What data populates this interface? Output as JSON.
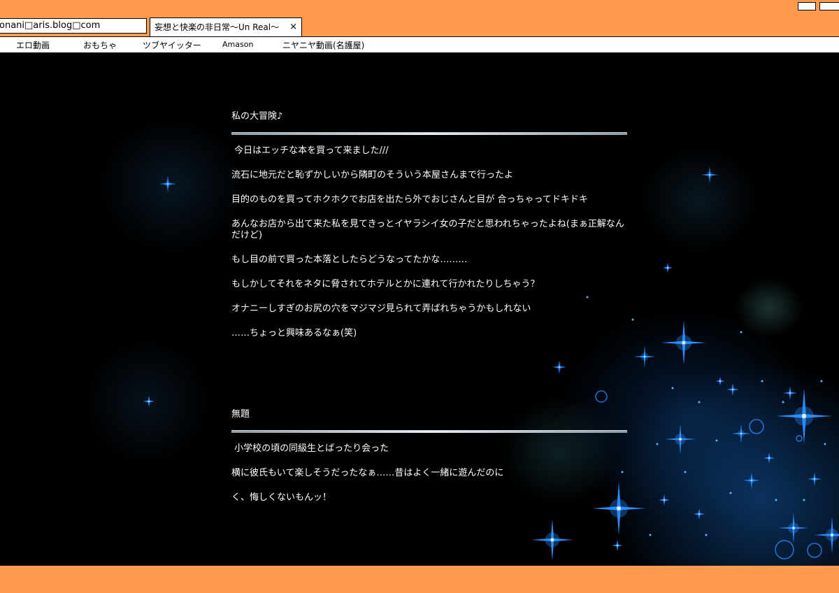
{
  "browser": {
    "address": "onani□aris.blog□com",
    "tab_title": "妄想と快楽の非日常〜Un Real〜",
    "tab_close": "×",
    "bookmarks": [
      "エロ動画",
      "おもちゃ",
      "ツブヤイッター",
      "Amason",
      "ニヤニヤ動画(名護屋)"
    ]
  },
  "posts": [
    {
      "title": "私の大冒険♪",
      "lines": [
        " 今日はエッチな本を買って来ました///",
        "流石に地元だと恥ずかしいから隣町のそういう本屋さんまで行ったよ",
        "目的のものを買ってホクホクでお店を出たら外でおじさんと目が 合っちゃってドキドキ",
        "あんなお店から出て来た私を見てきっとイヤラシイ女の子だと思われちゃったよね(まぁ正解なんだけど)",
        "もし目の前で買った本落としたらどうなってたかな………",
        "もしかしてそれをネタに脅されてホテルとかに連れて行かれたりしちゃう？",
        "オナニーしすぎのお尻の穴をマジマジ見られて弄ばれちゃうかもしれない",
        "……ちょっと興味あるなぁ(笑)"
      ]
    },
    {
      "title": "無題",
      "lines": [
        " 小学校の頃の同級生とばったり会った",
        "横に彼氏もいて楽しそうだったなぁ……昔はよく一緒に遊んだのに",
        "く、悔しくないもんッ！"
      ]
    }
  ],
  "colors": {
    "chrome": "#ff9a4e",
    "content_bg": "#000000",
    "text": "#ffffff",
    "sparkle": "#2a8cff"
  }
}
